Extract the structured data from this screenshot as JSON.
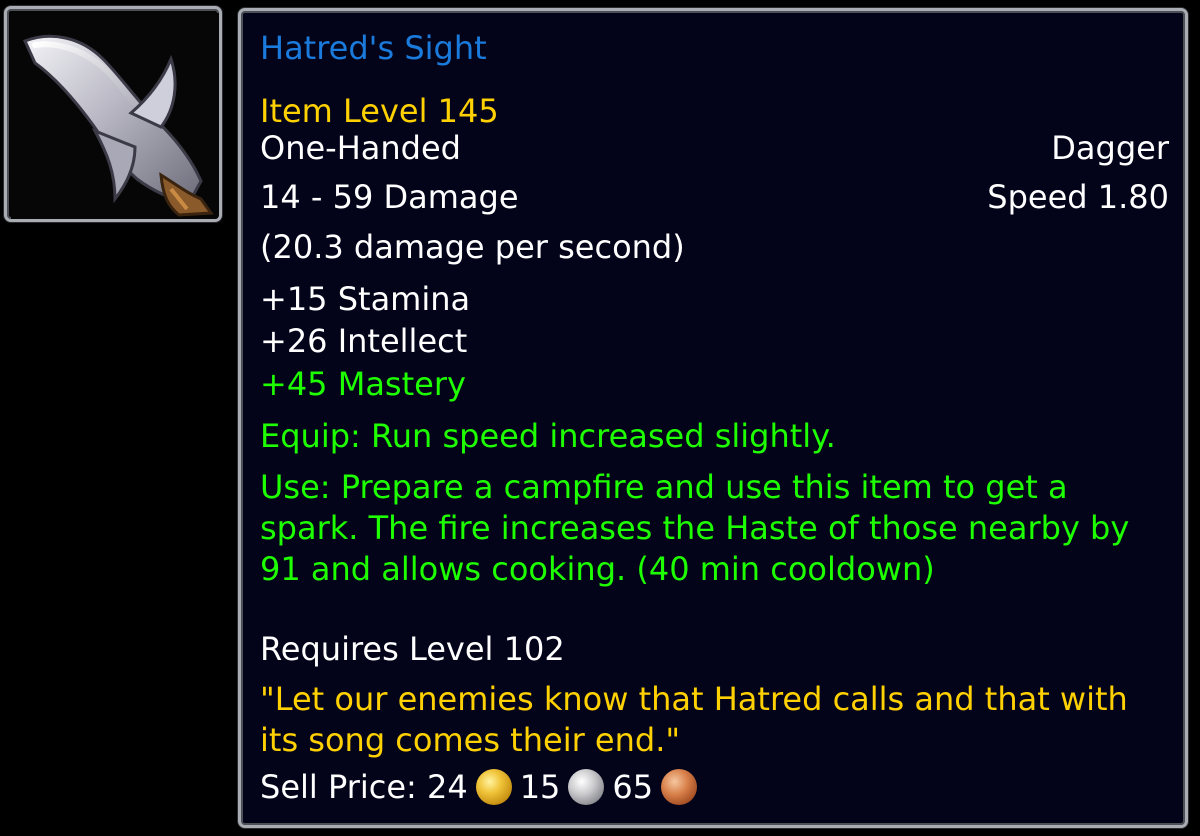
{
  "item": {
    "icon": "dagger-icon",
    "name": "Hatred's Sight",
    "item_level": "Item Level 145",
    "slot": "One-Handed",
    "type": "Dagger",
    "damage": "14 - 59 Damage",
    "speed": "Speed 1.80",
    "dps": "(20.3 damage per second)",
    "stats": {
      "stamina": "+15 Stamina",
      "intellect": "+26 Intellect",
      "mastery": "+45 Mastery"
    },
    "equip_effect": "Equip: Run speed increased slightly.",
    "use_effect": "Use: Prepare a campfire and use this item to get a spark. The fire increases the Haste of those nearby by 91 and allows cooking. (40 min cooldown)",
    "requires": "Requires Level 102",
    "flavor_text": "\"Let our enemies know that Hatred calls and that with its song comes their end.\"",
    "sell_price": {
      "label": "Sell Price:",
      "gold": "24",
      "silver": "15",
      "copper": "65"
    }
  },
  "colors": {
    "name": "#1a7bdc",
    "item_level": "#ffd100",
    "effect": "#1eff00",
    "flavor": "#ffd100",
    "background": "#03041a",
    "border": "#a9adb3"
  }
}
